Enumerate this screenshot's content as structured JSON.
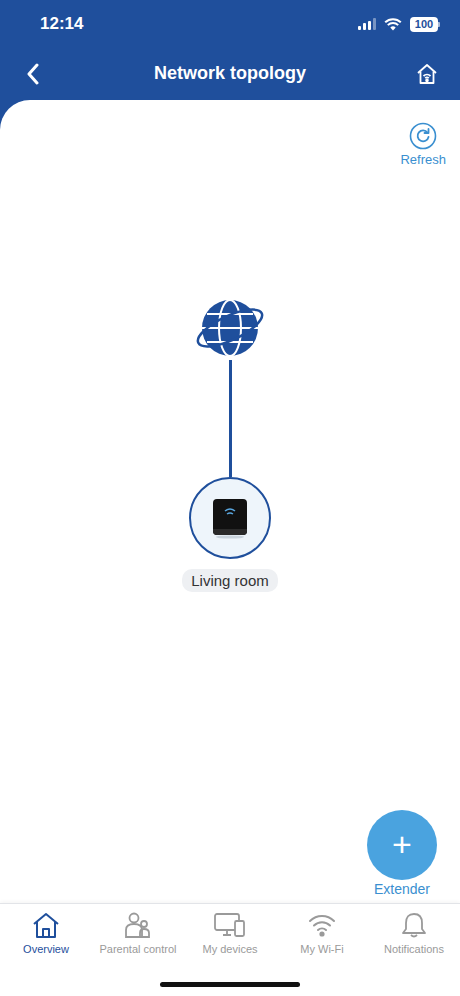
{
  "status_bar": {
    "time": "12:14",
    "signal_level": 0.75,
    "battery": "100"
  },
  "header": {
    "title": "Network topology"
  },
  "refresh": {
    "label": "Refresh"
  },
  "topology": {
    "nodes": [
      {
        "label": "Living room"
      }
    ]
  },
  "fab": {
    "icon": "+",
    "label": "Extender"
  },
  "tabs": [
    {
      "label": "Overview",
      "selected": true
    },
    {
      "label": "Parental control",
      "selected": false
    },
    {
      "label": "My devices",
      "selected": false
    },
    {
      "label": "My Wi-Fi",
      "selected": false
    },
    {
      "label": "Notifications",
      "selected": false
    }
  ]
}
